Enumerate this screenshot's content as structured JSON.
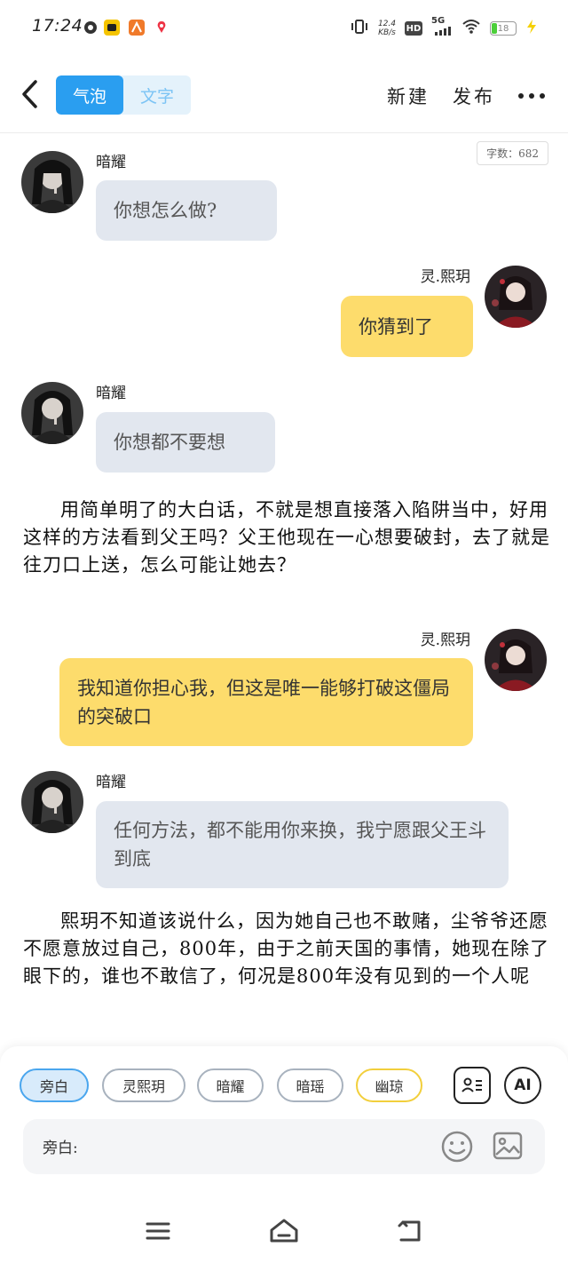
{
  "status_bar": {
    "time": "17:24",
    "net_speed_value": "12.4",
    "net_speed_unit": "KB/s",
    "hd": "HD",
    "network": "5G",
    "battery": "18"
  },
  "header": {
    "back_icon": "chevron-left-icon",
    "mode_bubble": "气泡",
    "mode_text": "文字",
    "new_label": "新建",
    "publish_label": "发布",
    "more_icon": "more-dots-icon"
  },
  "word_count": "字数：682",
  "messages": [
    {
      "side": "left",
      "sender": "暗耀",
      "text": "你想怎么做?"
    },
    {
      "side": "right",
      "sender": "灵.熙玥",
      "text": "你猜到了"
    },
    {
      "side": "left",
      "sender": "暗耀",
      "text": "你想都不要想"
    },
    {
      "side": "right",
      "sender": "灵.熙玥",
      "text": "我知道你担心我，但这是唯一能够打破这僵局的突破口"
    },
    {
      "side": "left",
      "sender": "暗耀",
      "text": "任何方法，都不能用你来换，我宁愿跟父王斗到底"
    }
  ],
  "narrations": [
    "用简单明了的大白话，不就是想直接落入陷阱当中，好用这样的方法看到父王吗？父王他现在一心想要破封，去了就是往刀口上送，怎么可能让她去？",
    "熙玥不知道该说什么，因为她自己也不敢赌，尘爷爷还愿不愿意放过自己，800年，由于之前天国的事情，她现在除了眼下的，谁也不敢信了，何况是800年没有见到的一个人呢"
  ],
  "characters": [
    {
      "label": "旁白",
      "state": "selected"
    },
    {
      "label": "灵熙玥",
      "state": "normal"
    },
    {
      "label": "暗耀",
      "state": "normal"
    },
    {
      "label": "暗瑶",
      "state": "normal"
    },
    {
      "label": "幽琼",
      "state": "yellow"
    }
  ],
  "toolbar": {
    "contacts_icon": "character-list-icon",
    "ai_label": "AI"
  },
  "input": {
    "label": "旁白:",
    "value": "",
    "emoji_icon": "emoji-icon",
    "image_icon": "image-icon"
  },
  "navbar": {
    "menu_icon": "menu-icon",
    "home_icon": "home-icon",
    "back_icon": "back-icon"
  },
  "colors": {
    "accent_blue": "#2a9ef0",
    "left_bubble": "#e2e7ef",
    "right_bubble": "#fddc6c"
  }
}
